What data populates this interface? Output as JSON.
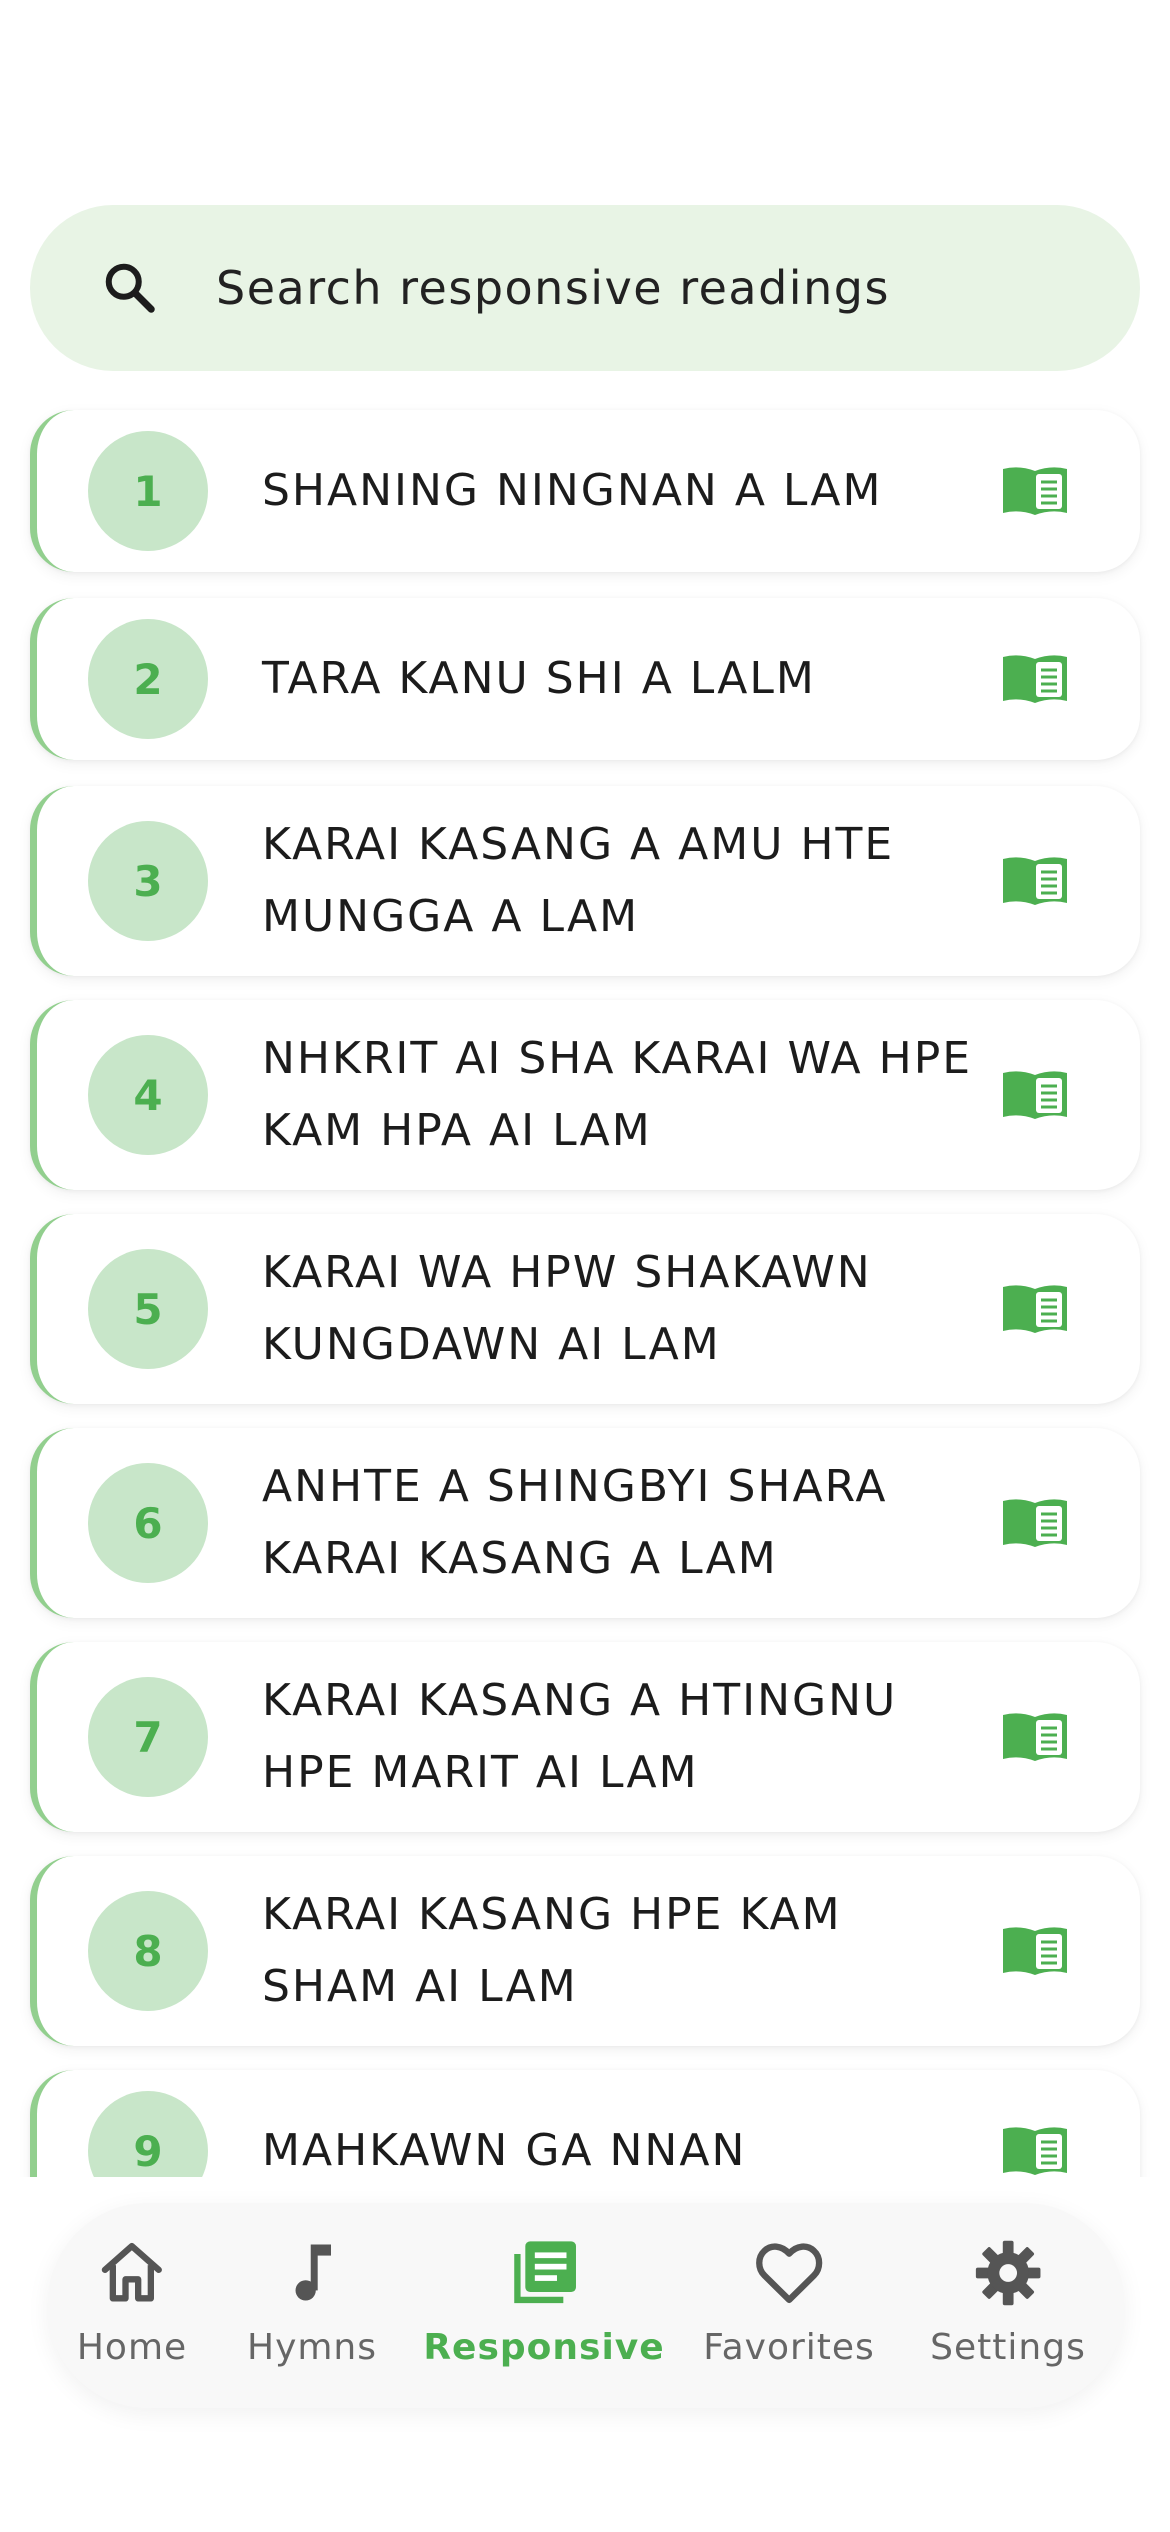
{
  "search": {
    "placeholder": "Search responsive readings"
  },
  "readings": [
    {
      "number": "1",
      "title": "SHANING NINGNAN A LAM"
    },
    {
      "number": "2",
      "title": "TARA KANU SHI A LALM"
    },
    {
      "number": "3",
      "title": "KARAI KASANG A AMU HTE MUNGGA A LAM"
    },
    {
      "number": "4",
      "title": "NHKRIT AI SHA KARAI WA HPE KAM HPA AI LAM"
    },
    {
      "number": "5",
      "title": "KARAI WA HPW SHAKAWN KUNGDAWN AI LAM"
    },
    {
      "number": "6",
      "title": "ANHTE A SHINGBYI SHARA KARAI KASANG A LAM"
    },
    {
      "number": "7",
      "title": "KARAI KASANG A HTINGNU HPE MARIT AI LAM"
    },
    {
      "number": "8",
      "title": "KARAI KASANG HPE KAM SHAM AI LAM"
    },
    {
      "number": "9",
      "title": "MAHKAWN GA NNAN"
    }
  ],
  "nav": {
    "home": "Home",
    "hymns": "Hymns",
    "responsive": "Responsive",
    "favorites": "Favorites",
    "settings": "Settings"
  },
  "colors": {
    "accent": "#4caf50",
    "accent_light": "#c8e6c9",
    "search_bg": "#e8f4e5"
  }
}
